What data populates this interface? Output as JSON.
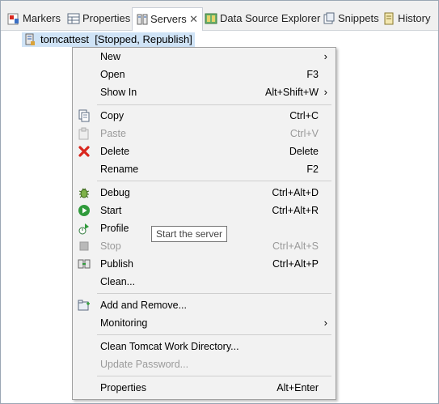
{
  "tabs": [
    {
      "label": "Markers",
      "icon": "markers-icon"
    },
    {
      "label": "Properties",
      "icon": "properties-icon"
    },
    {
      "label": "Servers",
      "icon": "servers-icon",
      "active": true,
      "close": "✕"
    },
    {
      "label": "Data Source Explorer",
      "icon": "data-source-explorer-icon"
    },
    {
      "label": "Snippets",
      "icon": "snippets-icon"
    },
    {
      "label": "History",
      "icon": "history-icon"
    }
  ],
  "server_row": {
    "label": "tomcattest  [Stopped, Republish]",
    "icon": "server-icon"
  },
  "menu": {
    "items": [
      {
        "label": "New",
        "shortcut": "",
        "submenu": true
      },
      {
        "label": "Open",
        "shortcut": "F3"
      },
      {
        "label": "Show In",
        "shortcut": "Alt+Shift+W",
        "submenu": true
      },
      {
        "label": "Copy",
        "shortcut": "Ctrl+C",
        "icon": "copy-icon"
      },
      {
        "label": "Paste",
        "shortcut": "Ctrl+V",
        "icon": "paste-icon",
        "disabled": true
      },
      {
        "label": "Delete",
        "shortcut": "Delete",
        "icon": "delete-icon"
      },
      {
        "label": "Rename",
        "shortcut": "F2"
      },
      {
        "label": "Debug",
        "shortcut": "Ctrl+Alt+D",
        "icon": "debug-icon"
      },
      {
        "label": "Start",
        "shortcut": "Ctrl+Alt+R",
        "icon": "start-icon"
      },
      {
        "label": "Profile",
        "shortcut": "",
        "icon": "profile-icon"
      },
      {
        "label": "Stop",
        "shortcut": "Ctrl+Alt+S",
        "icon": "stop-icon",
        "disabled": true
      },
      {
        "label": "Publish",
        "shortcut": "Ctrl+Alt+P",
        "icon": "publish-icon"
      },
      {
        "label": "Clean...",
        "shortcut": ""
      },
      {
        "label": "Add and Remove...",
        "shortcut": "",
        "icon": "add-remove-icon"
      },
      {
        "label": "Monitoring",
        "shortcut": "",
        "submenu": true
      },
      {
        "label": "Clean Tomcat Work Directory...",
        "shortcut": ""
      },
      {
        "label": "Update Password...",
        "shortcut": "",
        "disabled": true
      },
      {
        "label": "Properties",
        "shortcut": "Alt+Enter"
      }
    ],
    "submenu_arrow": "›"
  },
  "tooltip": {
    "text": "Start the server"
  },
  "colors": {
    "selection": "#cfe3f6",
    "menu_bg": "#f2f2f2",
    "disabled_text": "#9a9a9a",
    "delete_red": "#d9271e",
    "start_green": "#2f9a3b"
  }
}
